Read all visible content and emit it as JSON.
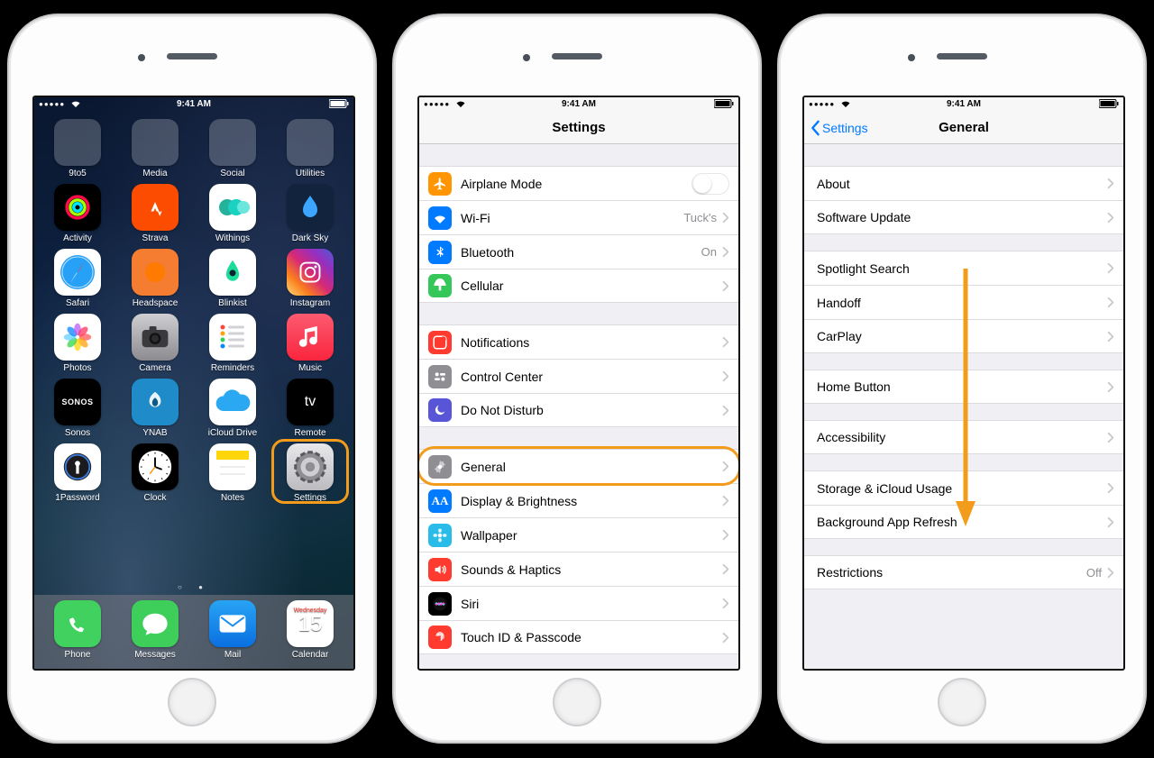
{
  "status": {
    "time": "9:41 AM"
  },
  "home": {
    "folders": [
      {
        "label": "9to5",
        "cells": [
          "#3a7bf0",
          "#ef6b2f",
          "#116a3b",
          "#e04343",
          "#e6e6ea",
          "#000",
          "#33a0ff",
          "#ddd",
          "transparent"
        ]
      },
      {
        "label": "Media",
        "cells": [
          "#fb4b2b",
          "#f0d83b",
          "#1ab9e6",
          "#6bd04e",
          "#a952e6",
          "#fecb45",
          "#e34b3c",
          "#000",
          "#2f6b7f"
        ]
      },
      {
        "label": "Social",
        "cells": [
          "#3aa2f2",
          "#f7d14a",
          "#1da1f2",
          "#3b5998",
          "#000",
          "#ee583f",
          "#ff0050",
          "#f3f3f3",
          "#0a66c2"
        ]
      },
      {
        "label": "Utilities",
        "cells": [
          "#5ed06f",
          "#f7be3f",
          "#2aa3ef",
          "#514e9e",
          "#fff",
          "#64b7ff",
          "#e33b33",
          "#e7e8eb",
          "transparent"
        ]
      }
    ],
    "apps_rows": [
      [
        {
          "label": "Activity",
          "bg": "#000000",
          "glyph_svg": "activity"
        },
        {
          "label": "Strava",
          "bg": "#fc4c02",
          "glyph_svg": "strava"
        },
        {
          "label": "Withings",
          "bg": "#ffffff",
          "glyph_svg": "withings"
        },
        {
          "label": "Dark Sky",
          "bg": "#12233d",
          "glyph_svg": "darksky"
        }
      ],
      [
        {
          "label": "Safari",
          "bg": "#ffffff",
          "glyph_svg": "safari"
        },
        {
          "label": "Headspace",
          "bg": "#f47d31",
          "glyph_svg": "headspace"
        },
        {
          "label": "Blinkist",
          "bg": "#ffffff",
          "glyph_svg": "blinkist"
        },
        {
          "label": "Instagram",
          "bg": "linear-gradient(45deg,#feda75,#fa7e1e,#d62976,#962fbf,#4f5bd5)",
          "glyph_svg": "instagram"
        }
      ],
      [
        {
          "label": "Photos",
          "bg": "#ffffff",
          "glyph_svg": "photos"
        },
        {
          "label": "Camera",
          "bg": "linear-gradient(#cfcfd2,#8b8b90)",
          "glyph_svg": "camera"
        },
        {
          "label": "Reminders",
          "bg": "#ffffff",
          "glyph_svg": "reminders"
        },
        {
          "label": "Music",
          "bg": "linear-gradient(#fb5b70,#fa253e)",
          "glyph_svg": "music"
        }
      ],
      [
        {
          "label": "Sonos",
          "bg": "#000000",
          "glyph_txt": "SONOS",
          "txt_style": "font-size:9px;font-weight:700;letter-spacing:.5px;"
        },
        {
          "label": "YNAB",
          "bg": "#1f8bc9",
          "glyph_svg": "ynab"
        },
        {
          "label": "iCloud Drive",
          "bg": "#ffffff",
          "glyph_svg": "icloud"
        },
        {
          "label": "Remote",
          "bg": "#000000",
          "glyph_svg": "appletv"
        }
      ],
      [
        {
          "label": "1Password",
          "bg": "#ffffff",
          "glyph_svg": "onepw"
        },
        {
          "label": "Clock",
          "bg": "#000000",
          "glyph_svg": "clock"
        },
        {
          "label": "Notes",
          "bg": "#ffffff",
          "glyph_svg": "notes"
        },
        {
          "label": "Settings",
          "bg": "linear-gradient(#e8e8ea,#bcbcc0)",
          "glyph_svg": "gear",
          "highlight": true
        }
      ]
    ],
    "dock": [
      {
        "label": "Phone",
        "bg": "#40d15e",
        "glyph_svg": "phone"
      },
      {
        "label": "Messages",
        "bg": "#3ecf5b",
        "glyph_svg": "messages"
      },
      {
        "label": "Mail",
        "bg": "linear-gradient(#28a4f4,#0a6fe0)",
        "glyph_svg": "mail"
      },
      {
        "label": "Calendar",
        "bg": "#ffffff",
        "glyph_svg": "calendar",
        "cal_weekday": "Wednesday",
        "cal_day": "15"
      }
    ]
  },
  "settings": {
    "title": "Settings",
    "groups": [
      [
        {
          "label": "Airplane Mode",
          "icon_bg": "#ff9502",
          "glyph": "airplane",
          "control": "toggle"
        },
        {
          "label": "Wi-Fi",
          "icon_bg": "#007aff",
          "glyph": "wifi",
          "detail": "Tuck's"
        },
        {
          "label": "Bluetooth",
          "icon_bg": "#007aff",
          "glyph": "bluetooth",
          "detail": "On"
        },
        {
          "label": "Cellular",
          "icon_bg": "#35c759",
          "glyph": "cellular"
        }
      ],
      [
        {
          "label": "Notifications",
          "icon_bg": "#ff3b30",
          "glyph": "notif"
        },
        {
          "label": "Control Center",
          "icon_bg": "#8e8e93",
          "glyph": "cc"
        },
        {
          "label": "Do Not Disturb",
          "icon_bg": "#5856d6",
          "glyph": "moon"
        }
      ],
      [
        {
          "label": "General",
          "icon_bg": "#8e8e93",
          "glyph": "gear2",
          "highlight": true
        },
        {
          "label": "Display & Brightness",
          "icon_bg": "#007aff",
          "glyph": "aa"
        },
        {
          "label": "Wallpaper",
          "icon_bg": "#29bce8",
          "glyph": "flower"
        },
        {
          "label": "Sounds & Haptics",
          "icon_bg": "#ff3b30",
          "glyph": "sound"
        },
        {
          "label": "Siri",
          "icon_bg": "#000000",
          "glyph": "siri"
        },
        {
          "label": "Touch ID & Passcode",
          "icon_bg": "#ff3b30",
          "glyph": "fingerprint"
        }
      ]
    ]
  },
  "general": {
    "back": "Settings",
    "title": "General",
    "groups": [
      [
        {
          "label": "About"
        },
        {
          "label": "Software Update"
        }
      ],
      [
        {
          "label": "Spotlight Search"
        },
        {
          "label": "Handoff"
        },
        {
          "label": "CarPlay"
        }
      ],
      [
        {
          "label": "Home Button"
        }
      ],
      [
        {
          "label": "Accessibility"
        }
      ],
      [
        {
          "label": "Storage & iCloud Usage"
        },
        {
          "label": "Background App Refresh"
        }
      ],
      [
        {
          "label": "Restrictions",
          "detail": "Off"
        }
      ]
    ]
  }
}
